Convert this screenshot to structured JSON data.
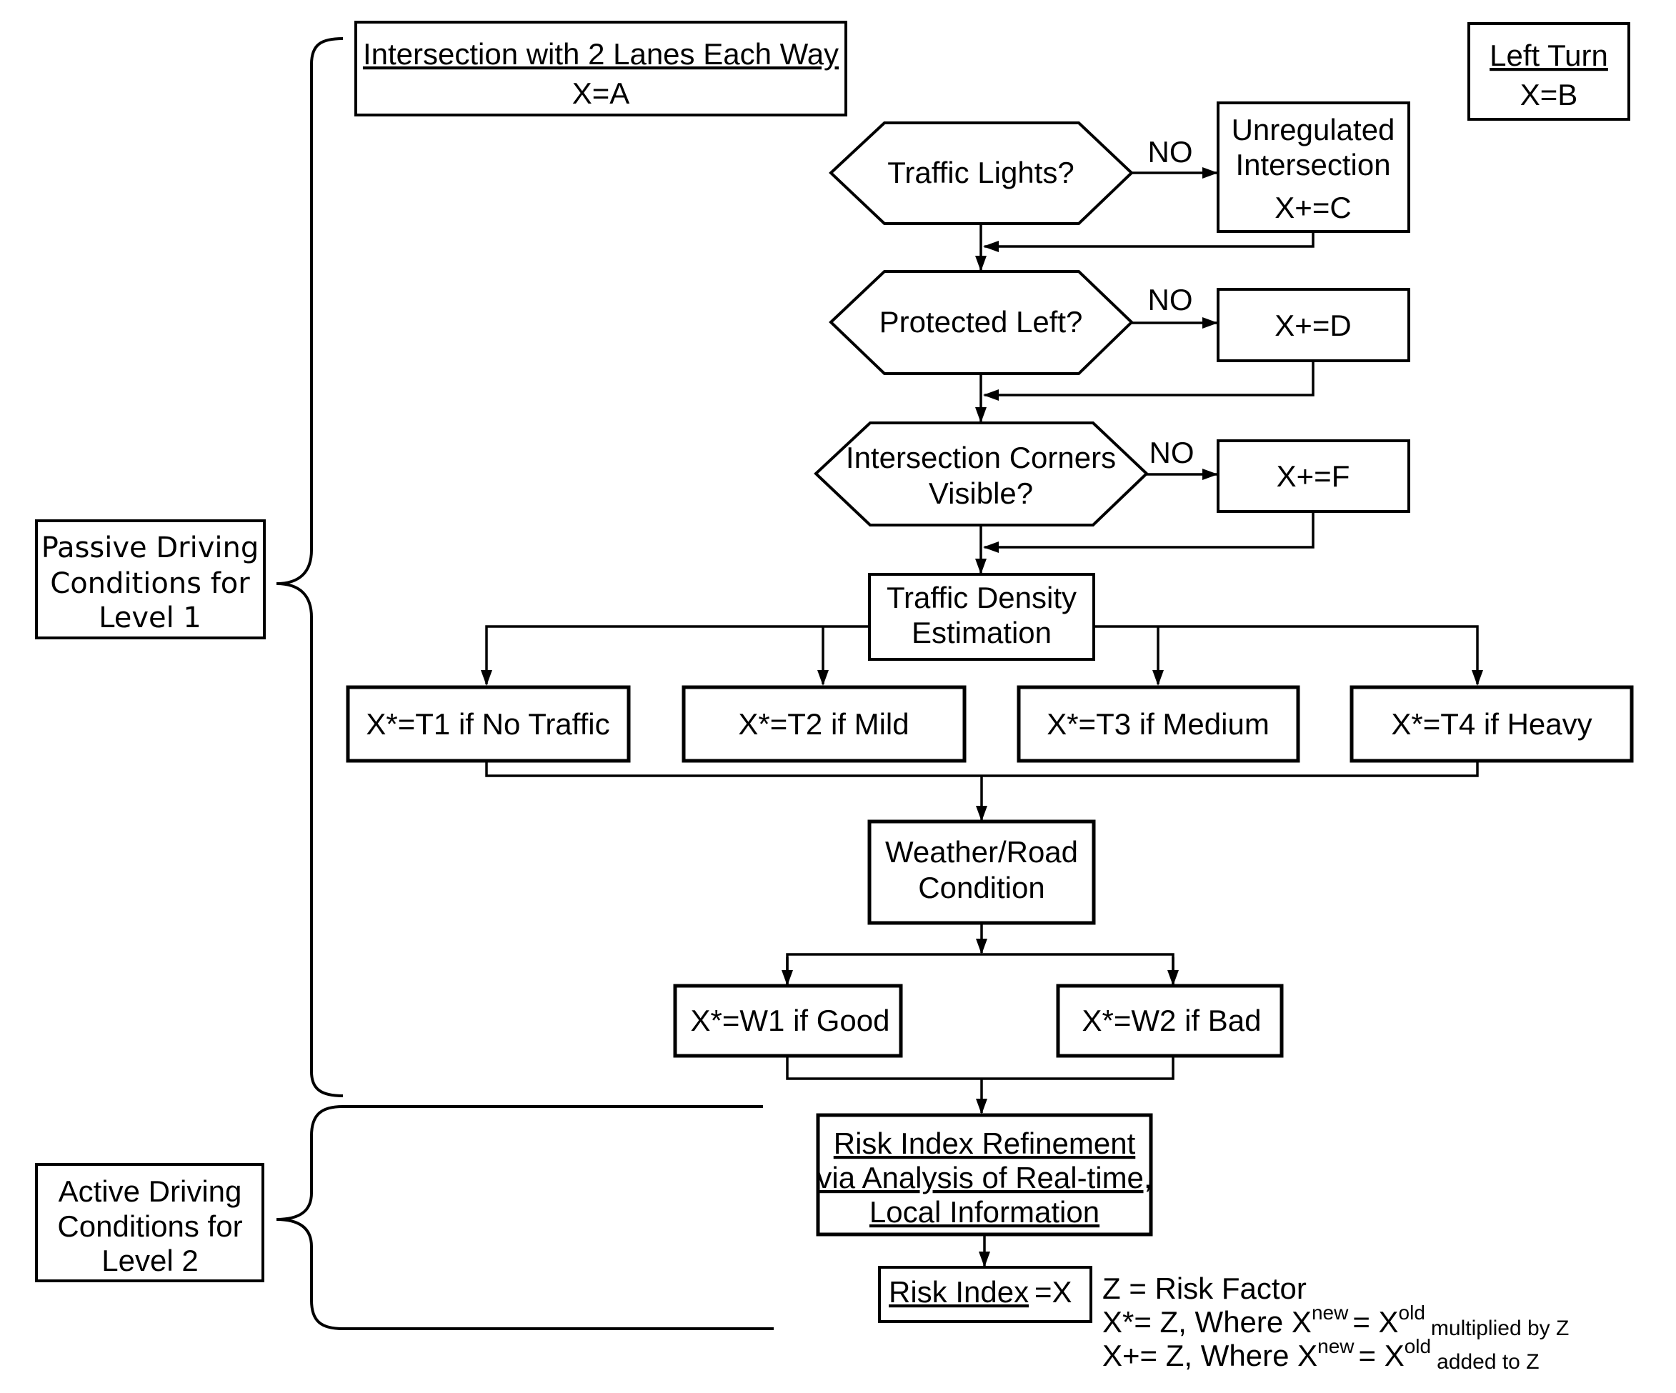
{
  "diagram": {
    "header": {
      "title": "Intersection with  2 Lanes Each Way",
      "assignment": "X=A"
    },
    "maneuver": {
      "title": "Left Turn",
      "assignment": "X=B"
    },
    "decisions": [
      {
        "question": "Traffic Lights?",
        "branch_label": "NO",
        "result_lines": [
          "Unregulated",
          "Intersection",
          "X+=C"
        ]
      },
      {
        "question": "Protected Left?",
        "branch_label": "NO",
        "result_lines": [
          "X+=D"
        ]
      },
      {
        "question_lines": [
          "Intersection Corners",
          "Visible?"
        ],
        "branch_label": "NO",
        "result_lines": [
          "X+=F"
        ]
      }
    ],
    "traffic_density": {
      "title_lines": [
        "Traffic Density",
        "Estimation"
      ],
      "options": [
        "X*=T1 if No Traffic",
        "X*=T2 if Mild",
        "X*=T3 if Medium",
        "X*=T4 if Heavy"
      ]
    },
    "weather": {
      "title_lines": [
        "Weather/Road",
        "Condition"
      ],
      "options": [
        "X*=W1 if Good",
        "X*=W2 if Bad"
      ]
    },
    "refinement": {
      "lines": [
        "Risk Index Refinement",
        "via Analysis of Real-time,",
        "Local Information"
      ]
    },
    "result": {
      "label": "Risk Index",
      "value": "=X"
    },
    "legend": {
      "line1": "Z = Risk Factor",
      "line2": {
        "prefix": "X*= Z, Where X",
        "sup1": "new",
        "mid": "=  X",
        "sup2": "old",
        "suffix": "multiplied by Z"
      },
      "line3": {
        "prefix": "X+= Z, Where X",
        "sup1": "new",
        "mid": "= X",
        "sup2": "old",
        "suffix": "added to Z"
      }
    },
    "levels": [
      {
        "lines": [
          "Passive Driving",
          "Conditions for",
          "Level 1"
        ]
      },
      {
        "lines": [
          "Active Driving",
          "Conditions for",
          "Level 2"
        ]
      }
    ]
  }
}
